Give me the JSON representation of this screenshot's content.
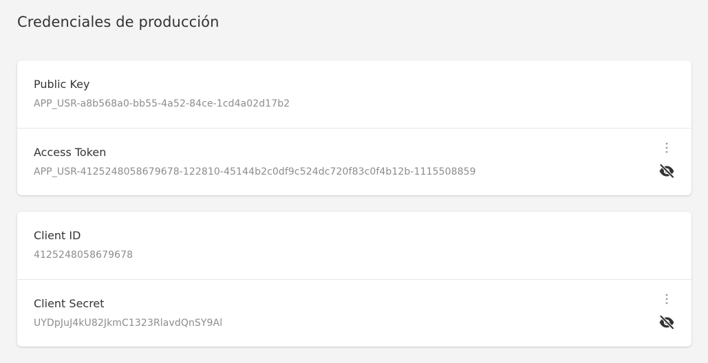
{
  "page": {
    "title": "Credenciales de producción"
  },
  "cards": [
    {
      "rows": [
        {
          "label": "Public Key",
          "value": "APP_USR-a8b568a0-bb55-4a52-84ce-1cd4a02d17b2",
          "has_actions": false
        },
        {
          "label": "Access Token",
          "value": "APP_USR-4125248058679678-122810-45144b2c0df9c524dc720f83c0f4b12b-1115508859",
          "has_actions": true
        }
      ]
    },
    {
      "rows": [
        {
          "label": "Client ID",
          "value": "4125248058679678",
          "has_actions": false
        },
        {
          "label": "Client Secret",
          "value": "UYDpJuJ4kU82JkmC1323RlavdQnSY9Al",
          "has_actions": true
        }
      ]
    }
  ],
  "icons": {
    "more": "more-vertical-icon",
    "visibility": "eye-off-icon"
  },
  "colors": {
    "background": "#f4f4f5",
    "card": "#ffffff",
    "label": "#333333",
    "value": "#8c8c8c",
    "icon": "#333333",
    "more_icon": "#9a9a9a"
  }
}
